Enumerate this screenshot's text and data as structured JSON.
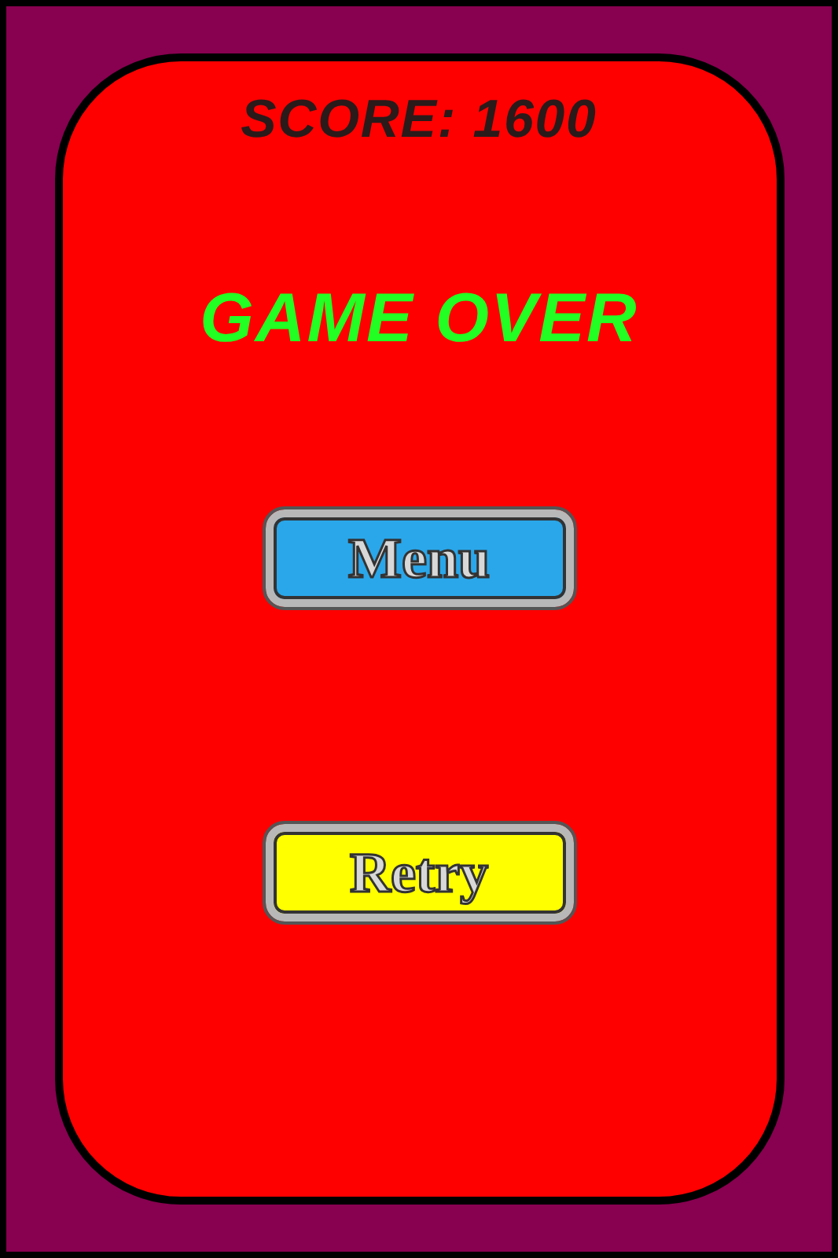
{
  "score": "SCORE: 1600",
  "title": "GAME OVER",
  "buttons": [
    {
      "label": "Menu",
      "kind": "blue"
    },
    {
      "label": "Retry",
      "kind": "yellow"
    }
  ]
}
